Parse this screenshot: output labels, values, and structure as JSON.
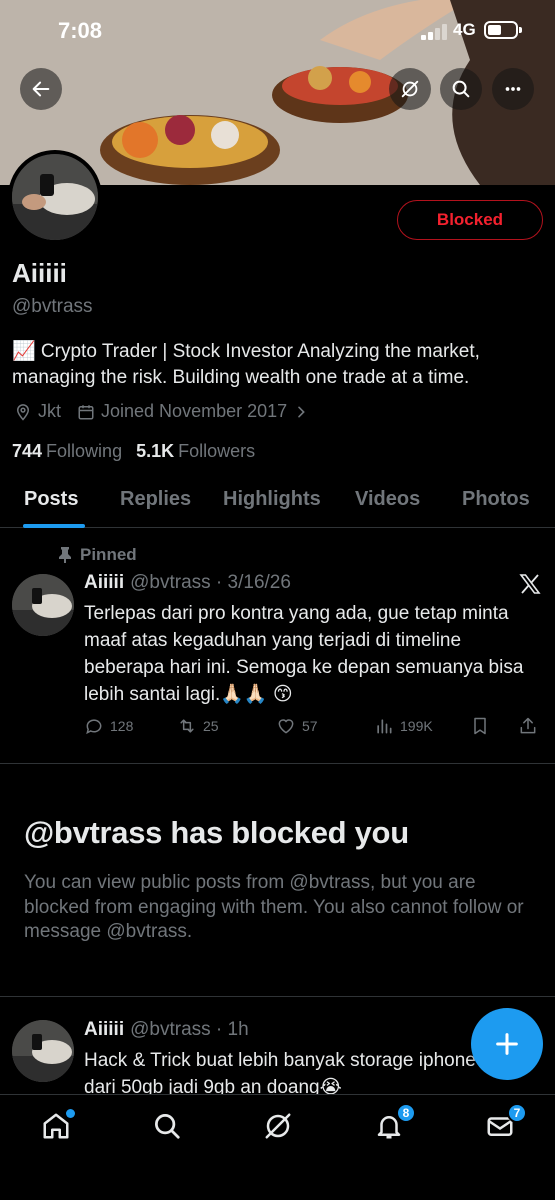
{
  "status_bar": {
    "time": "7:08",
    "network": "4G"
  },
  "banner": {
    "description_icons": [
      "back-icon",
      "grok-icon",
      "search-icon",
      "more-icon"
    ]
  },
  "profile": {
    "name": "Aiiiii",
    "handle": "@bvtrass",
    "bio": "📈 Crypto Trader | Stock Investor Analyzing the market, managing the risk. Building wealth one trade at a time.",
    "location": "Jkt",
    "joined": "Joined November 2017",
    "following_count": "744",
    "following_label": "Following",
    "followers_count": "5.1K",
    "followers_label": "Followers",
    "blocked_button": "Blocked"
  },
  "tabs": [
    {
      "label": "Posts"
    },
    {
      "label": "Replies"
    },
    {
      "label": "Highlights"
    },
    {
      "label": "Videos"
    },
    {
      "label": "Photos"
    }
  ],
  "pinned_post": {
    "pinned_label": "Pinned",
    "name": "Aiiiii",
    "handle_date": "@bvtrass · 3/16/26",
    "text": "Terlepas dari pro kontra yang ada, gue tetap minta maaf atas kegaduhan yang terjadi di timeline beberapa hari ini. Semoga ke depan semuanya bisa lebih santai lagi.🙏🏻🙏🏻 😙",
    "replies": "128",
    "reposts": "25",
    "likes": "57",
    "views": "199K"
  },
  "blocked_notice": {
    "title": "@bvtrass has blocked you",
    "description": "You can view public posts from @bvtrass, but you are blocked from engaging with them. You also cannot follow or message @bvtrass."
  },
  "second_post": {
    "name": "Aiiiii",
    "handle_time": "@bvtrass · 1h",
    "text_line1": "Hack & Trick buat lebih banyak storage iphone",
    "text_line2": "dari 50gb jadi 9gb an doang😭"
  },
  "bottom_nav": {
    "notifications_badge": "8",
    "messages_badge": "7"
  },
  "colors": {
    "accent": "#1d9bf0",
    "blocked": "#f4212e",
    "muted": "#71767b"
  }
}
